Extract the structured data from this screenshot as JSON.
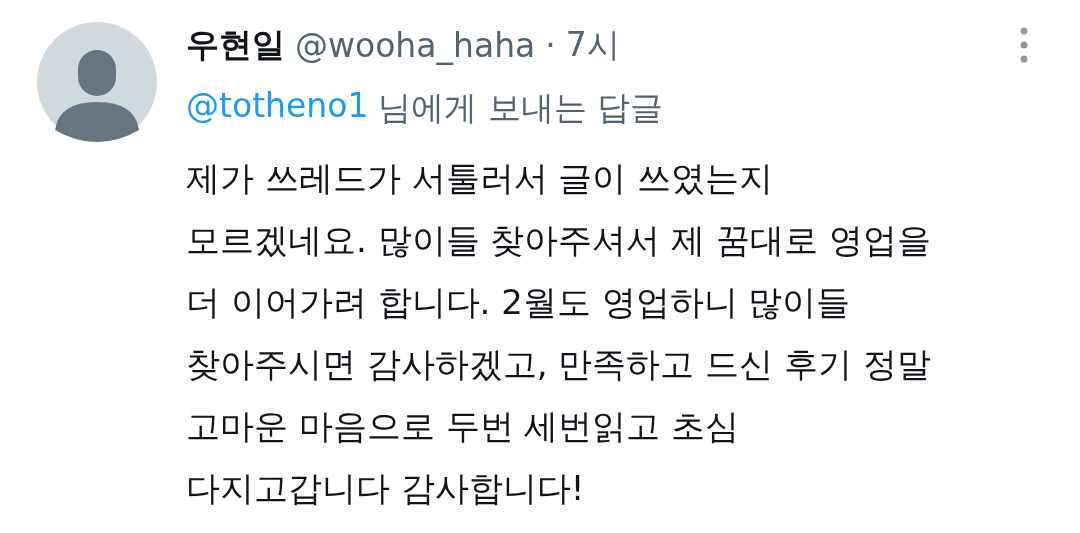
{
  "tweet": {
    "author": {
      "name": "우현일",
      "handle": "@wooha_haha",
      "separator": "·",
      "time": "7시"
    },
    "reply_to": {
      "handle": "@totheno1",
      "text": "님에게 보내는 답글"
    },
    "body": "제가 쓰레드가 서툴러서 글이 쓰였는지\n모르겠네요. 많이들 찾아주셔서 제 꿈대로 영업을\n더 이어가려 합니다. 2월도 영업하니 많이들\n찾아주시면 감사하겠고, 만족하고 드신 후기 정말\n고마운 마음으로 두번 세번읽고 초심\n다지고갑니다 감사합니다!"
  }
}
